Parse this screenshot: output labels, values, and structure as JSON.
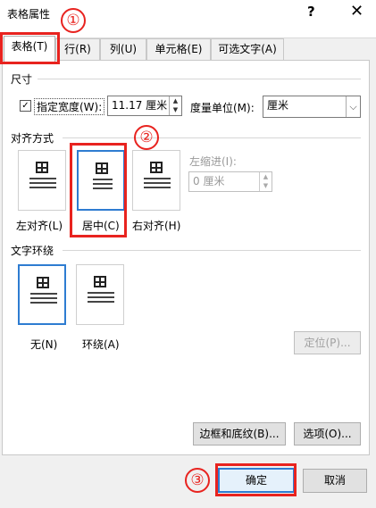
{
  "window": {
    "title": "表格属性",
    "help": "?",
    "close": "✕"
  },
  "tabs": [
    {
      "label": "表格(T)",
      "active": true
    },
    {
      "label": "行(R)",
      "active": false
    },
    {
      "label": "列(U)",
      "active": false
    },
    {
      "label": "单元格(E)",
      "active": false
    },
    {
      "label": "可选文字(A)",
      "active": false
    }
  ],
  "size": {
    "heading": "尺寸",
    "specify_width_label": "指定宽度(W):",
    "specify_width_checked": "✓",
    "width_value": "11.17 厘米",
    "unit_label": "度量单位(M):",
    "unit_value": "厘米"
  },
  "alignment": {
    "heading": "对齐方式",
    "options": [
      "左对齐(L)",
      "居中(C)",
      "右对齐(H)"
    ],
    "selected": "居中(C)",
    "indent_label": "左缩进(I):",
    "indent_value": "0 厘米"
  },
  "wrapping": {
    "heading": "文字环绕",
    "options": [
      "无(N)",
      "环绕(A)"
    ],
    "selected": "无(N)",
    "position_button": "定位(P)..."
  },
  "buttons": {
    "borders_shading": "边框和底纹(B)...",
    "options": "选项(O)...",
    "ok": "确定",
    "cancel": "取消"
  },
  "annotations": [
    "①",
    "②",
    "③"
  ],
  "colors": {
    "annotation_red": "#e8231f",
    "selection_blue": "#2e7cd1"
  }
}
